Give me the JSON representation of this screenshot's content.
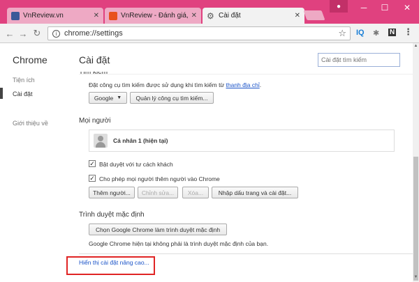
{
  "tabs": [
    {
      "title": "VnReview.vn",
      "favicon": "facebook-favicon"
    },
    {
      "title": "VnReview - Đánh giá, tin",
      "favicon": "vnreview-favicon"
    },
    {
      "title": "Cài đặt",
      "favicon": "gear-favicon"
    }
  ],
  "toolbar": {
    "url": "chrome://settings",
    "extensions": [
      "IQ",
      "N"
    ]
  },
  "sidebar": {
    "brand": "Chrome",
    "items": [
      {
        "label": "Tiện ích"
      },
      {
        "label": "Cài đặt"
      },
      {
        "label": "Giới thiệu về"
      }
    ]
  },
  "main": {
    "title": "Cài đặt",
    "search_placeholder": "Cài đặt tìm kiếm",
    "search": {
      "heading": "Tìm kiếm",
      "desc": "Đặt công cụ tìm kiếm được sử dụng khi tìm kiếm từ",
      "desc_link": "thanh địa chỉ",
      "desc_end": ".",
      "engine": "Google",
      "manage_button": "Quản lý công cụ tìm kiếm..."
    },
    "people": {
      "heading": "Mọi người",
      "profile_name": "Cá nhân 1 (hiện tại)",
      "guest_checkbox": {
        "label": "Bật duyệt với tư cách khách",
        "checked": true
      },
      "add_checkbox": {
        "label": "Cho phép mọi người thêm người vào Chrome",
        "checked": true
      },
      "buttons": {
        "add": "Thêm người...",
        "edit": "Chỉnh sửa...",
        "delete": "Xóa...",
        "import": "Nhập dấu trang và cài đặt..."
      }
    },
    "default_browser": {
      "heading": "Trình duyệt mặc định",
      "button": "Chọn Google Chrome làm trình duyệt mặc định",
      "status": "Google Chrome hiện tại không phải là trình duyệt mặc định của bạn."
    },
    "advanced_link": "Hiển thị cài đặt nâng cao..."
  },
  "colors": {
    "titlebar": "#e0417f",
    "highlight": "#e02424",
    "link": "#1a53c8"
  }
}
